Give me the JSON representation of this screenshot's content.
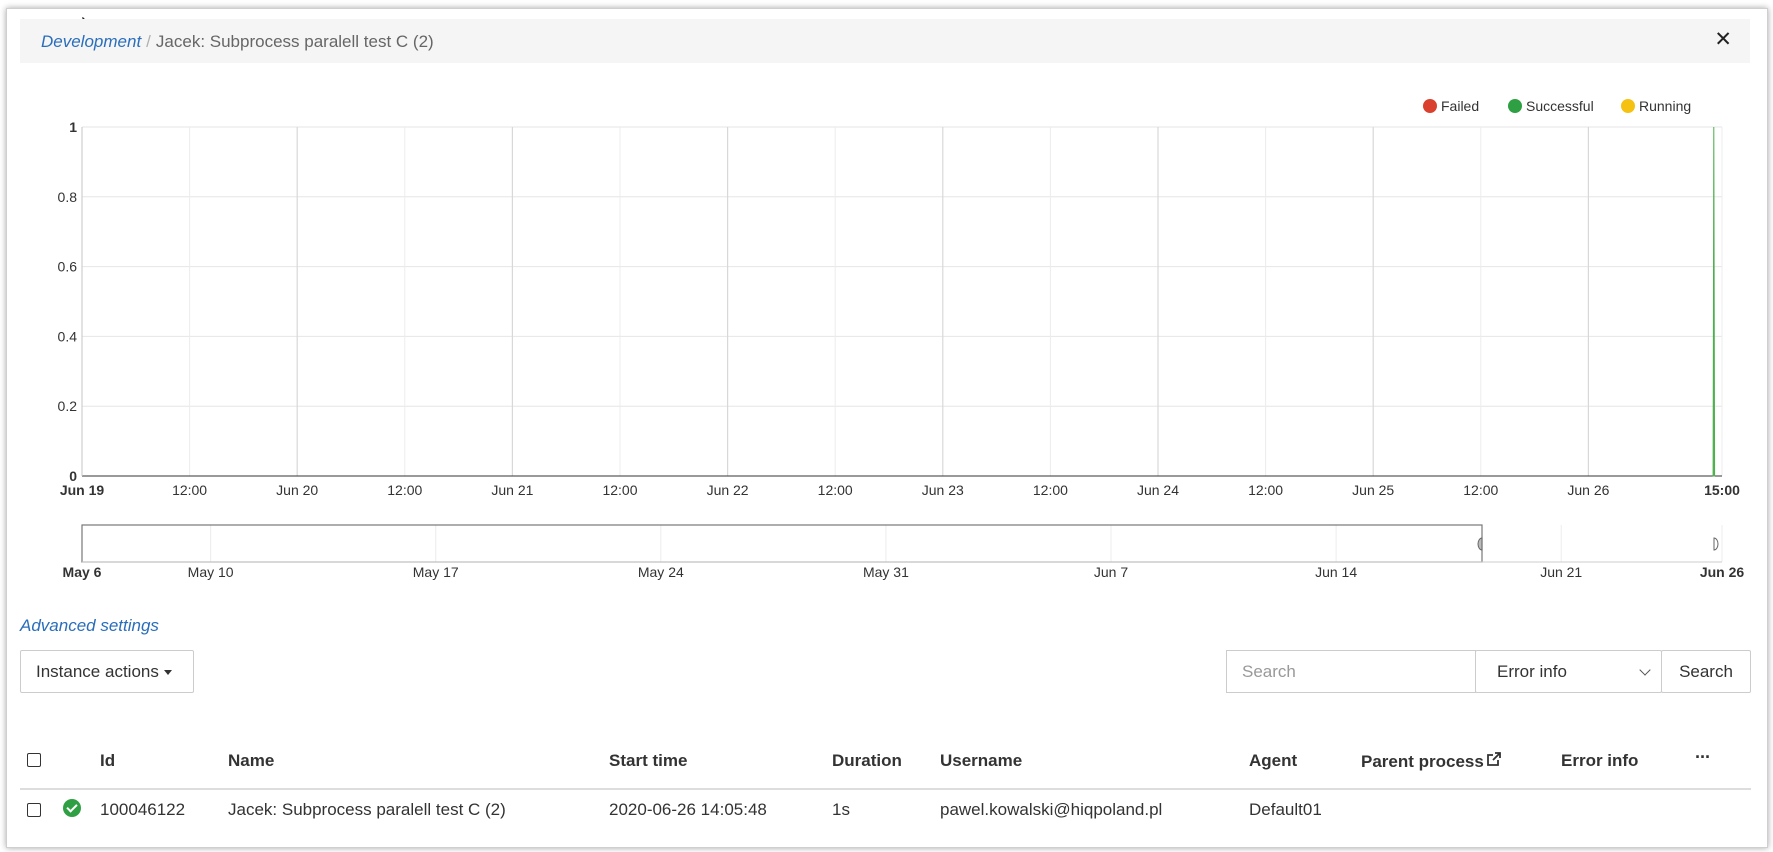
{
  "breadcrumb": {
    "root": "Development",
    "separator": "/",
    "current": "Jacek: Subprocess paralell test C (2)"
  },
  "colors": {
    "failed": "#d9412e",
    "successful": "#2ea043",
    "running": "#f5c211",
    "link": "#2a6ebb",
    "area": "#5cb85c"
  },
  "legend": [
    {
      "label": "Failed",
      "color": "#d9412e"
    },
    {
      "label": "Successful",
      "color": "#2ea043"
    },
    {
      "label": "Running",
      "color": "#f5c211"
    }
  ],
  "chart_data": {
    "type": "area",
    "y_ticks": [
      "0",
      "0.2",
      "0.4",
      "0.6",
      "0.8",
      "1"
    ],
    "ylim": [
      0,
      1
    ],
    "x_ticks": [
      "Jun 19",
      "12:00",
      "Jun 20",
      "12:00",
      "Jun 21",
      "12:00",
      "Jun 22",
      "12:00",
      "Jun 23",
      "12:00",
      "Jun 24",
      "12:00",
      "Jun 25",
      "12:00",
      "Jun 26",
      "15:00"
    ],
    "x_ticks_bold": [
      "Jun 19",
      "15:00"
    ],
    "grid": true,
    "series": [
      {
        "name": "Successful",
        "points": [
          {
            "x": "2020-06-26 14:00",
            "y": 0
          },
          {
            "x": "2020-06-26 14:05",
            "y": 1
          },
          {
            "x": "2020-06-26 14:10",
            "y": 0
          }
        ]
      }
    ],
    "navigator": {
      "ticks": [
        "May 6",
        "May 10",
        "May 17",
        "May 24",
        "May 31",
        "Jun 7",
        "Jun 14",
        "Jun 21",
        "Jun 26"
      ],
      "ticks_bold": [
        "May 6",
        "Jun 26"
      ]
    }
  },
  "advanced_settings": "Advanced settings",
  "toolbar": {
    "instance_actions": "Instance actions",
    "search_placeholder": "Search",
    "filter_selected": "Error info",
    "search_button": "Search"
  },
  "table": {
    "headers": {
      "id": "Id",
      "name": "Name",
      "start_time": "Start time",
      "duration": "Duration",
      "username": "Username",
      "agent": "Agent",
      "parent_process": "Parent process",
      "error_info": "Error info",
      "more": "···"
    },
    "rows": [
      {
        "status": "successful",
        "id": "100046122",
        "name": "Jacek: Subprocess paralell test C (2)",
        "start_time": "2020-06-26 14:05:48",
        "duration": "1s",
        "username": "pawel.kowalski@hiqpoland.pl",
        "agent": "Default01",
        "parent_process": "",
        "error_info": ""
      }
    ]
  }
}
